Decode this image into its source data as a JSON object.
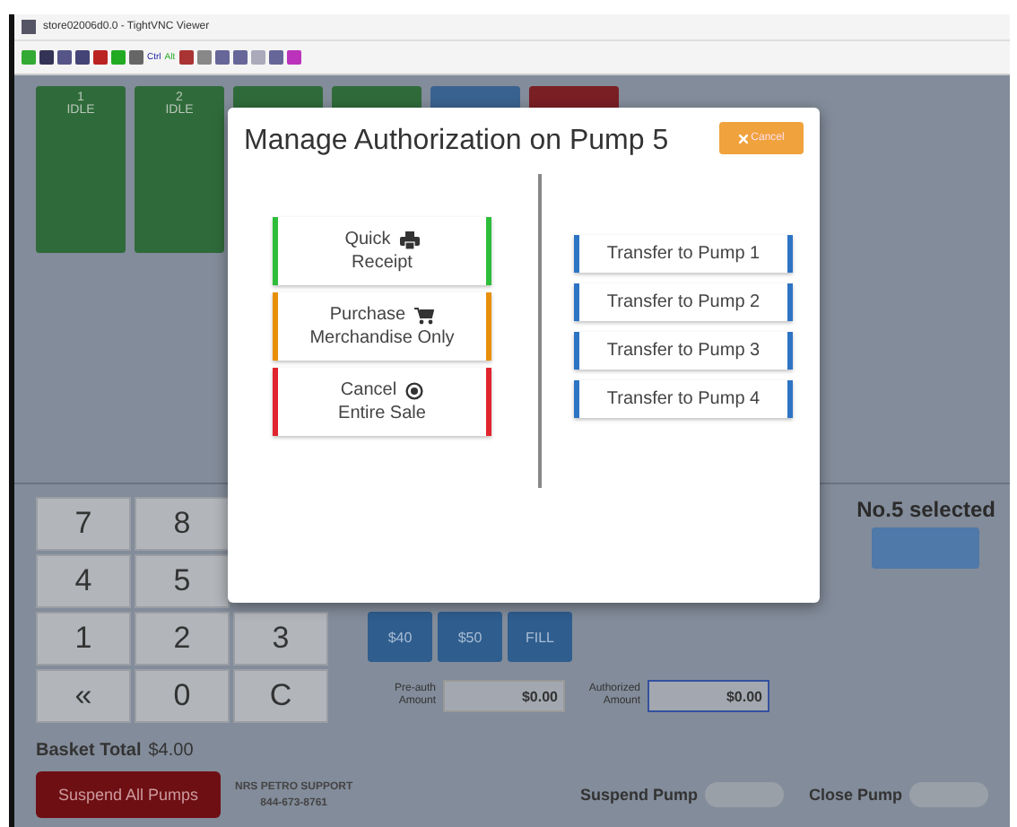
{
  "window": {
    "title": "store02006d0.0 - TightVNC Viewer"
  },
  "toolbar": {
    "keys": [
      "Ctrl",
      "Alt"
    ]
  },
  "pumps": [
    {
      "number": "1",
      "status": "IDLE",
      "color": "#2f6b3a"
    },
    {
      "number": "2",
      "status": "IDLE",
      "color": "#2f6b3a"
    },
    {
      "color": "#2f6b3a"
    },
    {
      "color": "#2f6b3a"
    },
    {
      "color": "#3a6290"
    },
    {
      "color": "#7a1f24"
    }
  ],
  "modal": {
    "title": "Manage Authorization on Pump 5",
    "cancel_button": "Cancel",
    "actions": [
      {
        "kind": "printer",
        "label": "Quick",
        "sublabel": "Receipt",
        "color": "#2ebd3a"
      },
      {
        "kind": "cart",
        "label": "Purchase",
        "sublabel": "Merchandise Only",
        "color": "#e8900c"
      },
      {
        "kind": "cancel",
        "label": "Cancel",
        "sublabel": "Entire Sale",
        "color": "#e0252f"
      }
    ],
    "transfers": [
      "Transfer to Pump 1",
      "Transfer to Pump 2",
      "Transfer to Pump 3",
      "Transfer to Pump 4"
    ]
  },
  "keypad": [
    [
      "7",
      "8"
    ],
    [
      "4",
      "5"
    ],
    [
      "1",
      "2",
      "3"
    ],
    [
      "«",
      "0",
      "C"
    ]
  ],
  "presets": [
    "$40",
    "$50",
    "FILL"
  ],
  "preauth": {
    "label": "Pre-auth Amount",
    "value": "$0.00"
  },
  "authorized": {
    "label": "Authorized Amount",
    "value": "$0.00"
  },
  "selection": {
    "text": "No.5 selected"
  },
  "basket": {
    "label": "Basket Total",
    "value": "$4.00"
  },
  "suspend_all_button": "Suspend All Pumps",
  "support": {
    "name": "NRS PETRO SUPPORT",
    "phone": "844-673-8761"
  },
  "pump_controls": [
    {
      "label": "Suspend Pump",
      "on": false
    },
    {
      "label": "Close Pump",
      "on": false
    }
  ]
}
